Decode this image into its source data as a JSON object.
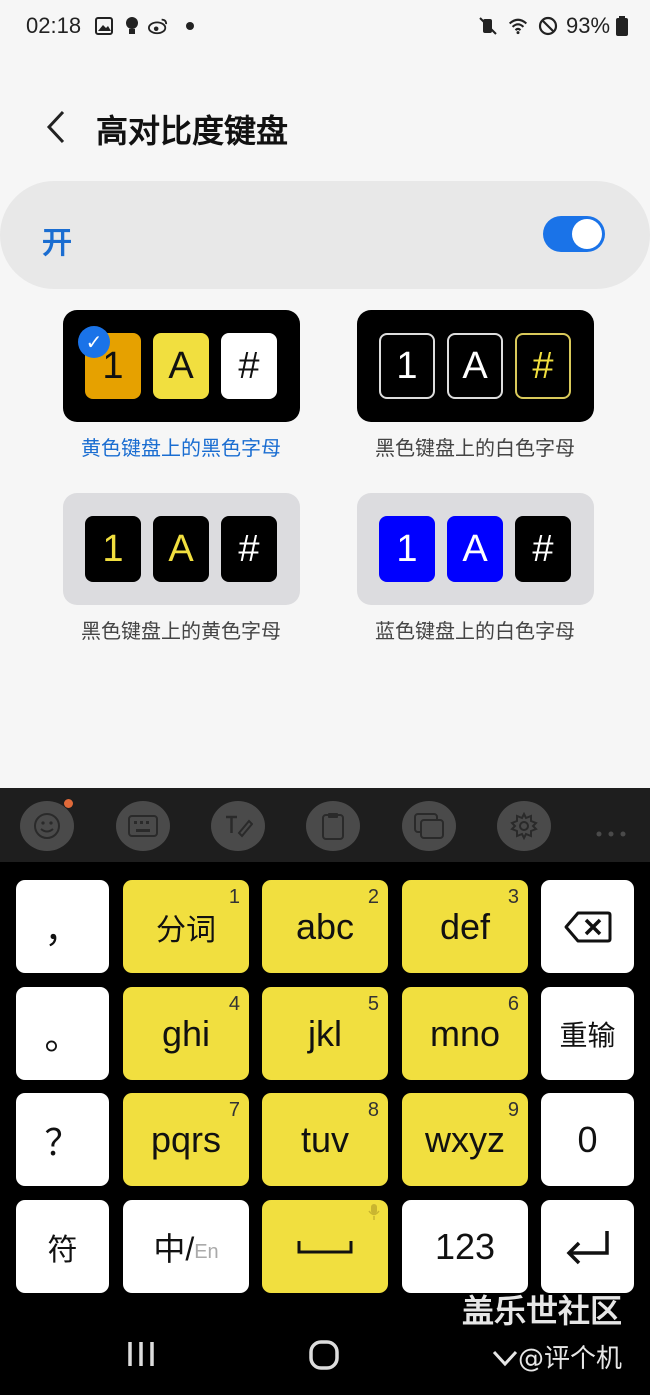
{
  "status_bar": {
    "time": "02:18",
    "battery": "93%"
  },
  "header": {
    "title": "高对比度键盘"
  },
  "toggle": {
    "label": "开",
    "state": "on"
  },
  "options": [
    {
      "label": "黄色键盘上的黑色字母",
      "selected": true,
      "keys": [
        "1",
        "A",
        "#"
      ]
    },
    {
      "label": "黑色键盘上的白色字母",
      "selected": false,
      "keys": [
        "1",
        "A",
        "#"
      ]
    },
    {
      "label": "黑色键盘上的黄色字母",
      "selected": false,
      "keys": [
        "1",
        "A",
        "#"
      ]
    },
    {
      "label": "蓝色键盘上的白色字母",
      "selected": false,
      "keys": [
        "1",
        "A",
        "#"
      ]
    }
  ],
  "colors": {
    "accent": "#1a73e8",
    "keyboard_yellow": "#f1df3f",
    "blue_key": "#0000ff"
  },
  "keyboard": {
    "toolbar_icons": [
      "emoji-icon",
      "keyboard-icon",
      "handwriting-icon",
      "clipboard-icon",
      "one-handed-icon",
      "settings-icon",
      "more-icon"
    ],
    "rows": [
      [
        {
          "main": "，"
        },
        {
          "main": "分词",
          "num": "1"
        },
        {
          "main": "abc",
          "num": "2"
        },
        {
          "main": "def",
          "num": "3"
        },
        {
          "main": "⌫"
        }
      ],
      [
        {
          "main": "。"
        },
        {
          "main": "ghi",
          "num": "4"
        },
        {
          "main": "jkl",
          "num": "5"
        },
        {
          "main": "mno",
          "num": "6"
        },
        {
          "main": "重输"
        }
      ],
      [
        {
          "main": "？"
        },
        {
          "main": "pqrs",
          "num": "7"
        },
        {
          "main": "tuv",
          "num": "8"
        },
        {
          "main": "wxyz",
          "num": "9"
        },
        {
          "main": "0"
        }
      ],
      [
        {
          "main": "符"
        },
        {
          "main": "中/",
          "sub": "En"
        },
        {
          "main": "␣"
        },
        {
          "main": "123"
        },
        {
          "main": "↵"
        }
      ]
    ]
  },
  "watermark": {
    "line1": "盖乐世社区",
    "line2": "@评个机"
  }
}
